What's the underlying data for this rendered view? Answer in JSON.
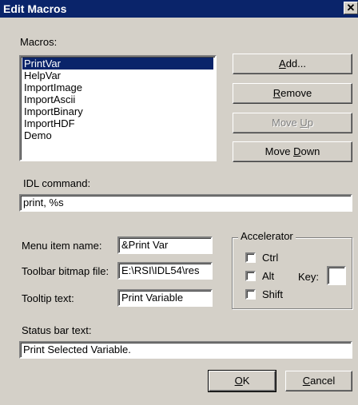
{
  "window": {
    "title": "Edit Macros",
    "close_glyph": "✕"
  },
  "macros": {
    "label": "Macros:",
    "items": [
      "PrintVar",
      "HelpVar",
      "ImportImage",
      "ImportAscii",
      "ImportBinary",
      "ImportHDF",
      "Demo"
    ],
    "selected_index": 0
  },
  "buttons": {
    "add": {
      "pre": "",
      "key": "A",
      "post": "dd..."
    },
    "remove": {
      "pre": "",
      "key": "R",
      "post": "emove"
    },
    "move_up": {
      "pre": "Move ",
      "key": "U",
      "post": "p",
      "disabled": true
    },
    "move_down": {
      "pre": "Move ",
      "key": "D",
      "post": "own"
    },
    "ok": {
      "pre": "",
      "key": "O",
      "post": "K"
    },
    "cancel": {
      "pre": "",
      "key": "C",
      "post": "ancel"
    }
  },
  "idl_command": {
    "label": "IDL command:",
    "value": "print, %s"
  },
  "menu_item_name": {
    "label": "Menu item name:",
    "value": "&Print Var"
  },
  "toolbar_bitmap_file": {
    "label": "Toolbar bitmap file:",
    "value": "E:\\RSI\\IDL54\\res"
  },
  "tooltip_text": {
    "label": "Tooltip text:",
    "value": "Print Variable"
  },
  "accelerator": {
    "title": "Accelerator",
    "ctrl": {
      "label": "Ctrl",
      "checked": false
    },
    "alt": {
      "label": "Alt",
      "checked": false
    },
    "shift": {
      "label": "Shift",
      "checked": false
    },
    "key_label": "Key:",
    "key_value": ""
  },
  "status_bar_text": {
    "label": "Status bar text:",
    "value": "Print Selected Variable."
  }
}
